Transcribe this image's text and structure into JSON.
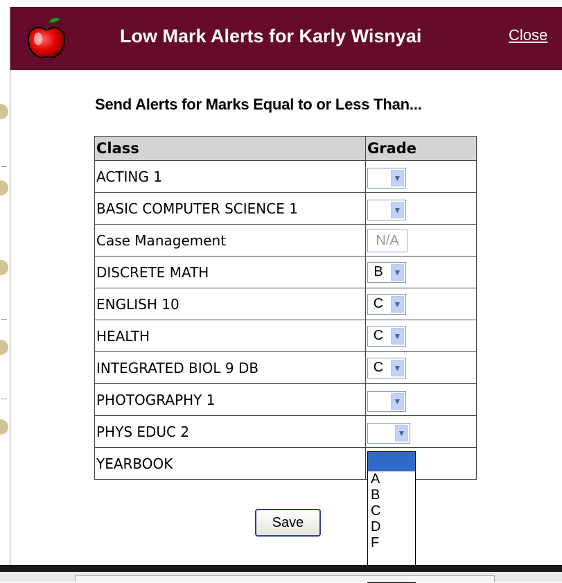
{
  "dialog": {
    "title": "Low Mark Alerts for Karly Wisnyai",
    "close_label": "Close",
    "subtitle": "Send Alerts for Marks Equal to or Less Than...",
    "save_label": "Save"
  },
  "table": {
    "headers": {
      "class": "Class",
      "grade": "Grade"
    },
    "rows": [
      {
        "class": "ACTING 1",
        "grade": "",
        "type": "select"
      },
      {
        "class": "BASIC COMPUTER SCIENCE 1",
        "grade": "",
        "type": "select"
      },
      {
        "class": "Case Management",
        "grade": "N/A",
        "type": "na"
      },
      {
        "class": "DISCRETE MATH",
        "grade": "B",
        "type": "select"
      },
      {
        "class": "ENGLISH 10",
        "grade": "C",
        "type": "select"
      },
      {
        "class": "HEALTH",
        "grade": "C",
        "type": "select"
      },
      {
        "class": "INTEGRATED BIOL 9 DB",
        "grade": "C",
        "type": "select"
      },
      {
        "class": "PHOTOGRAPHY 1",
        "grade": "",
        "type": "select"
      },
      {
        "class": "PHYS EDUC 2",
        "grade": "",
        "type": "select"
      },
      {
        "class": "YEARBOOK",
        "grade": "",
        "type": "open"
      }
    ]
  },
  "dropdown": {
    "options": [
      "",
      "A",
      "B",
      "C",
      "D",
      "F"
    ]
  },
  "colors": {
    "titlebar": "#660a2c",
    "selection": "#3169c6"
  },
  "icons": {
    "app": "apple-icon",
    "select_arrow": "chevron-down-icon"
  }
}
